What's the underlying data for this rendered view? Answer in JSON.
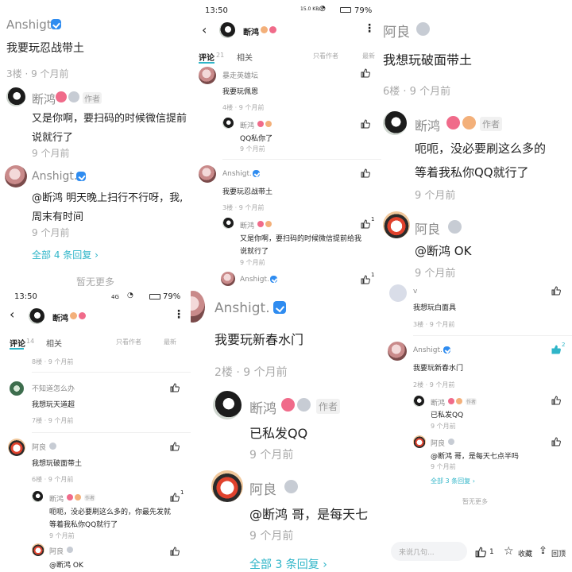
{
  "colors": {
    "accent": "#2fb5c8",
    "verified": "#2f8cf0",
    "name": "#8a8a8a",
    "meta": "#a8a8a8"
  },
  "p1": {
    "r1_name": "Anshigt.",
    "r1_text": "我要玩忍战带土",
    "r1_meta": "3楼 · 9 个月前",
    "r2_name": "断鸿",
    "r2_author": "作者",
    "r2_text1": "又是你啊，要扫码的时候微信提前",
    "r2_text2": "说就行了",
    "r2_meta": "9 个月前",
    "r3_name": "Anshigt.",
    "r3_text1": "@断鸿  明天晚上扫行不行呀，我,",
    "r3_text2": "周末有时间",
    "r3_meta": "9 个月前",
    "replies": "全部 4 条回复 ›",
    "nomore": "暂无更多"
  },
  "p2": {
    "time": "13:50",
    "signal": "15.0 KB/S",
    "battery": "79%",
    "title": "断鸿",
    "tab_comments": "评论",
    "tab_count": "21",
    "tab_related": "相关",
    "only_author": "只看作者",
    "latest": "最新",
    "c1_name": "暴走英雄坛",
    "c1_text": "我要玩佩恩",
    "c1_meta": "4楼 · 9 个月前",
    "c1r_name": "断鸿",
    "c1r_text": "QQ私你了",
    "c1r_meta": "9 个月前",
    "c2_name": "Anshigt.",
    "c2_text": "我要玩忍战带土",
    "c2_meta": "3楼 · 9 个月前",
    "c2r_name": "断鸿",
    "c2r_text1": "又是你啊，要扫码的时候微信提前给我",
    "c2r_text2": "说就行了",
    "c2r_meta": "9 个月前",
    "c2r_likes": "1",
    "c3_name": "Anshigt.",
    "c3_likes": "1"
  },
  "p3": {
    "r1_name": "阿良",
    "r1_text": "我想玩破面带土",
    "r1_meta": "6楼 · 9 个月前",
    "r2_name": "断鸿",
    "r2_author": "作者",
    "r2_text1": "呃呃，没必要刷这么多的",
    "r2_text2": "等着我私你QQ就行了",
    "r2_meta": "9 个月前",
    "r3_name": "阿良",
    "r3_text": "@断鸿  OK",
    "r3_meta": "9 个月前",
    "c1_name": "v",
    "c1_text": "我想玩白面具",
    "c1_meta": "3楼 · 9 个月前",
    "c2_name": "Anshigt.",
    "c2_text": "我要玩新春水门",
    "c2_meta": "2楼 · 9 个月前",
    "c2_likes": "2",
    "c2r1_name": "断鸿",
    "c2r1_author": "作者",
    "c2r1_text": "已私发QQ",
    "c2r1_meta": "9 个月前",
    "c2r2_name": "阿良",
    "c2r2_text": "@断鸿  哥，是每天七点半吗",
    "c2r2_meta": "9 个月前",
    "replies": "全部 3 条回复 ›",
    "nomore": "暂无更多",
    "input_placeholder": "来说几句...",
    "like_count": "1",
    "fav": "收藏",
    "reply": "回顶"
  },
  "p4": {
    "time": "13:50",
    "signal": "4G",
    "battery": "79%",
    "title": "断鸿",
    "tab_comments": "评论",
    "tab_count": "14",
    "tab_related": "相关",
    "only_author": "只看作者",
    "latest": "最新",
    "top_meta": "8楼 · 9 个月前",
    "c1_name": "不知道怎么办",
    "c1_text": "我想玩天道超",
    "c1_meta": "7楼 · 9 个月前",
    "c2_name": "阿良",
    "c2_text": "我想玩破面带土",
    "c2_meta": "6楼 · 9 个月前",
    "c2r_name": "断鸿",
    "c2r_author": "作者",
    "c2r_text1": "呃呃，没必要刷这么多的，你最先发就",
    "c2r_text2": "等着我私你QQ就行了",
    "c2r_meta": "9 个月前",
    "c2r_likes": "1",
    "c3_name": "阿良",
    "c3_text": "@断鸿  OK"
  },
  "p5": {
    "c1_name": "Anshigt.",
    "c1_text": "我要玩新春水门",
    "c1_meta": "2楼 · 9 个月前",
    "r1_name": "断鸿",
    "r1_author": "作者",
    "r1_text": "已私发QQ",
    "r1_meta": "9 个月前",
    "r2_name": "阿良",
    "r2_text": "@断鸿  哥，是每天七",
    "r2_meta": "9 个月前",
    "replies": "全部 3 条回复 ›"
  }
}
